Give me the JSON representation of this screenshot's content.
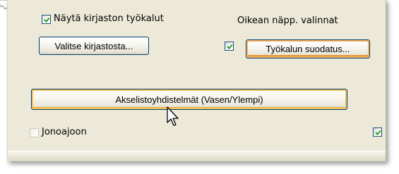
{
  "options": {
    "show_library_tools_label": "Näytä kirjaston työkalut",
    "show_library_tools_checked": true,
    "right_click_options_label": "Oikean näpp. valinnat",
    "select_from_library_button": "Valitse kirjastosta...",
    "tool_filter_checked": true,
    "tool_filter_button": "Työkalun suodatus...",
    "axis_system_button": "Akselistoyhdistelmät (Vasen/Ylempi)",
    "queue_run_label": "Jonoajoon",
    "queue_run_checked": false,
    "right_bottom_checked": true
  },
  "colors": {
    "panel_bg": "#ece9d8",
    "checkmark": "#21a121",
    "button_border": "#003c74",
    "hot_focus": "#f6c456"
  },
  "icons": [
    "checkmark-icon",
    "arrow-cursor-icon"
  ]
}
